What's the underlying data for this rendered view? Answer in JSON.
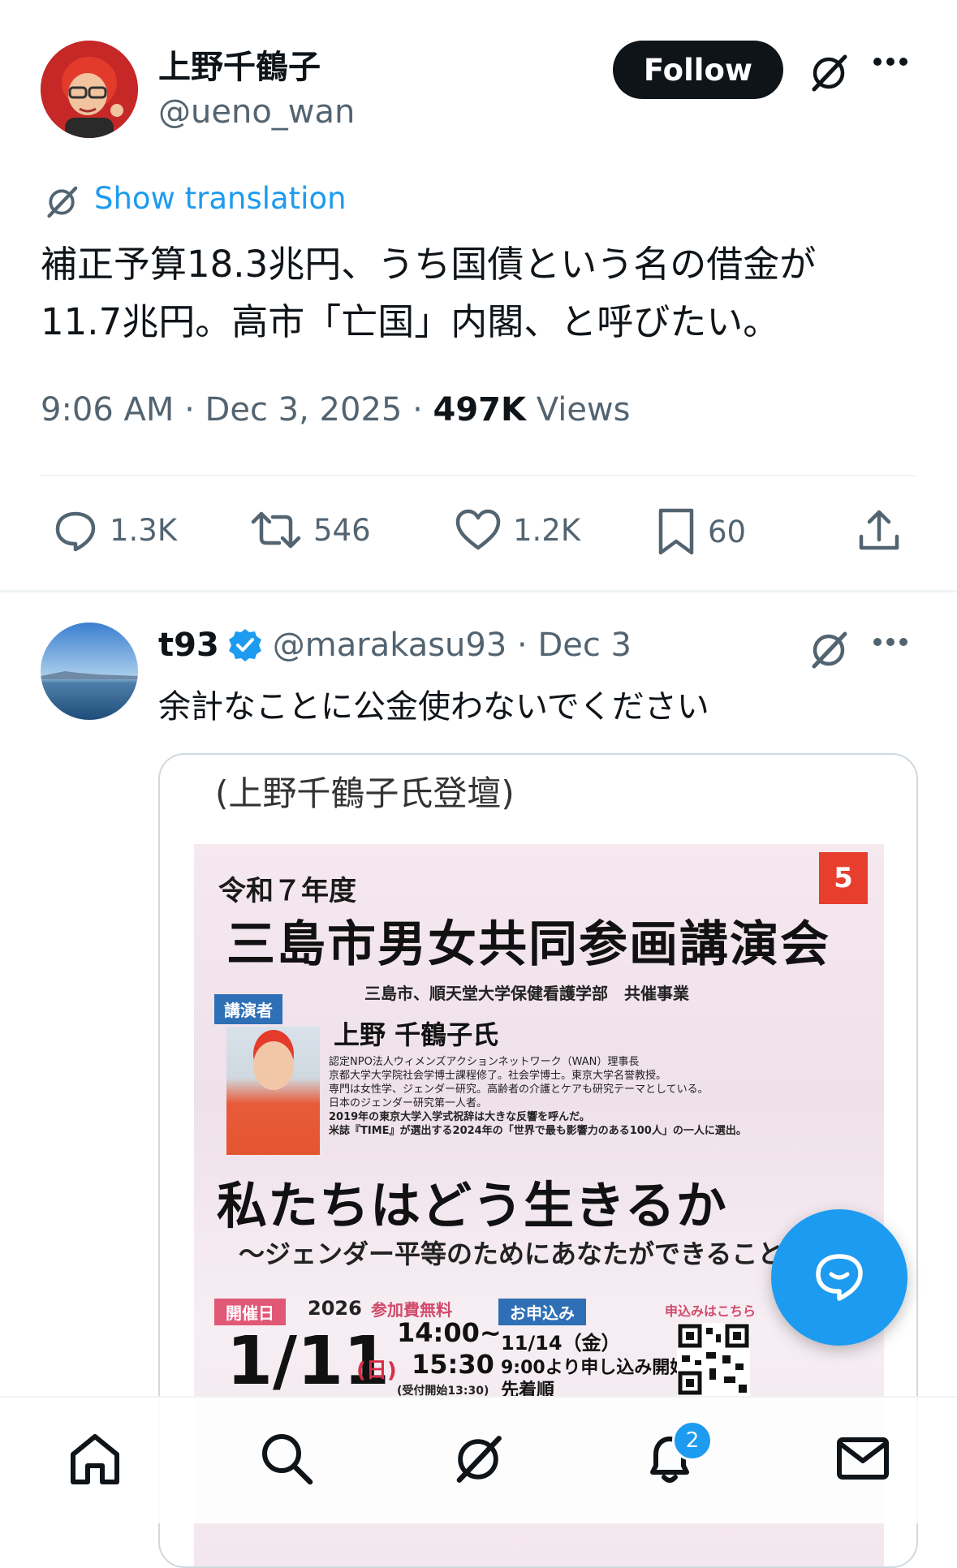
{
  "main_tweet": {
    "author_name": "上野千鶴子",
    "author_handle": "@ueno_wan",
    "follow_label": "Follow",
    "show_translation_label": "Show translation",
    "text_line1": "補正予算18.3兆円、うち国債という名の借金が",
    "text_line2": "11.7兆円。高市「亡国」内閣、と呼びたい。",
    "timestamp": "9:06 AM · Dec 3, 2025 · ",
    "views_count": "497K",
    "views_label": " Views",
    "actions": {
      "replies": "1.3K",
      "reposts": "546",
      "likes": "1.2K",
      "bookmarks": "60"
    }
  },
  "reply": {
    "author_name": "t93",
    "author_handle": "@marakasu93 · Dec 3",
    "text": "余計なことに公金使わないでください"
  },
  "poster": {
    "caption": "(上野千鶴子氏登壇)",
    "year": "令和７年度",
    "title": "三島市男女共同参画講演会",
    "cohost": "三島市、順天堂大学保健看護学部　共催事業",
    "speaker_tag": "講演者",
    "speaker_name": "上野 千鶴子氏",
    "bio": [
      "認定NPO法人ウィメンズアクションネットワーク（WAN）理事長",
      "京都大学大学院社会学博士課程修了。社会学博士。東京大学名誉教授。",
      "専門は女性学、ジェンダー研究。高齢者の介護とケアも研究テーマとしている。",
      "日本のジェンダー研究第一人者。",
      "2019年の東京大学入学式祝辞は大きな反響を呼んだ。",
      "米誌『TIME』が選出する2024年の「世界で最も影響力のある100人」の一人に選出。"
    ],
    "talk_title": "私たちはどう生きるか",
    "talk_subtitle": "～ジェンダー平等のためにあなたができること～",
    "date_tag": "開催日",
    "date_year": "2026",
    "fee": "参加費無料",
    "event_date": "1/11",
    "weekday": "(日)",
    "time_start": "14:00~",
    "time_end": "15:30",
    "reception": "(受付開始13:30)",
    "apply_tag": "お申込み",
    "apply_date": "11/14（金）",
    "apply_start": "9:00より申し込み開始",
    "apply_note": "先着順",
    "apply_here": "申込みはこちら",
    "sdg": "5"
  },
  "nav": {
    "notification_count": "2"
  },
  "colors": {
    "accent": "#1d9bf0",
    "text_primary": "#0f1419",
    "text_secondary": "#536471"
  }
}
